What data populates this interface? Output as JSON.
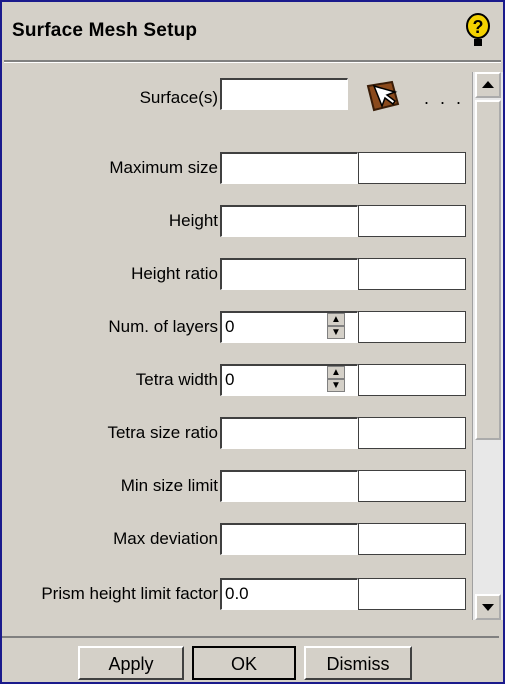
{
  "window": {
    "title": "Surface Mesh Setup"
  },
  "surfaces": {
    "label": "Surface(s)",
    "value": "",
    "more_label": ". . ."
  },
  "fields": [
    {
      "label": "Maximum size",
      "value": ""
    },
    {
      "label": "Height",
      "value": ""
    },
    {
      "label": "Height ratio",
      "value": ""
    },
    {
      "label": "Num. of layers",
      "value": "0"
    },
    {
      "label": "Tetra width",
      "value": "0"
    },
    {
      "label": "Tetra size ratio",
      "value": ""
    },
    {
      "label": "Min size limit",
      "value": ""
    },
    {
      "label": "Max deviation",
      "value": ""
    },
    {
      "label": "Prism height limit factor",
      "value": "0.0"
    }
  ],
  "buttons": {
    "apply": "Apply",
    "ok": "OK",
    "dismiss": "Dismiss"
  },
  "icons": {
    "help": "help-question-icon",
    "select": "select-surface-icon"
  },
  "colors": {
    "panel": "#d4d0c8",
    "frame": "#1a1a8c"
  }
}
